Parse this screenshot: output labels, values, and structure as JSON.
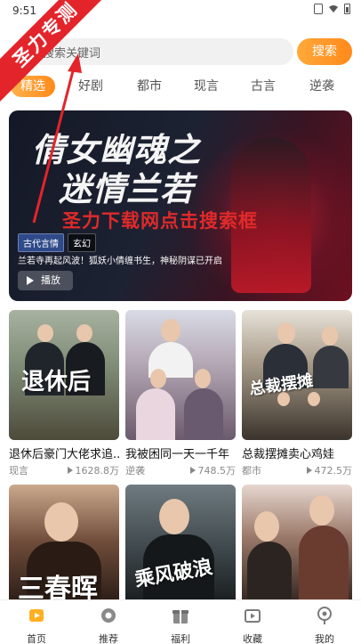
{
  "status_bar": {
    "time": "9:51"
  },
  "overlay": {
    "ribbon_text": "圣力专测",
    "banner_watermark": "圣力下载网点击搜索框"
  },
  "search": {
    "placeholder": "搜索关键词",
    "button_label": "搜索"
  },
  "tabs": [
    {
      "label": "精选",
      "active": true
    },
    {
      "label": "好剧",
      "active": false
    },
    {
      "label": "都市",
      "active": false
    },
    {
      "label": "现言",
      "active": false
    },
    {
      "label": "古言",
      "active": false
    },
    {
      "label": "逆袭",
      "active": false
    }
  ],
  "banner": {
    "title_line1": "倩女幽魂之",
    "title_line2": "迷情兰若",
    "tags": [
      "古代言情",
      "玄幻"
    ],
    "description": "兰若寺再起风波！狐妖小倩缠书生，神秘阴谋已开启",
    "play_label": "播放"
  },
  "cards": [
    {
      "title": "退休后豪门大佬求追...",
      "genre": "现言",
      "plays": "1628.8万",
      "poster_text": "退休后"
    },
    {
      "title": "我被困同一天一千年",
      "genre": "逆袭",
      "plays": "748.5万",
      "poster_text": ""
    },
    {
      "title": "总裁摆摊卖心鸡娃",
      "genre": "都市",
      "plays": "472.5万",
      "poster_text": "总裁摆摊"
    },
    {
      "title": "",
      "genre": "",
      "plays": "",
      "poster_text": "三春晖"
    },
    {
      "title": "",
      "genre": "",
      "plays": "",
      "poster_text": "乘风破浪"
    },
    {
      "title": "",
      "genre": "",
      "plays": "",
      "poster_text": ""
    }
  ],
  "bottom_nav": [
    {
      "label": "首页",
      "icon": "home-icon",
      "active": true
    },
    {
      "label": "推荐",
      "icon": "gear-icon",
      "active": false
    },
    {
      "label": "福利",
      "icon": "gift-icon",
      "active": false
    },
    {
      "label": "收藏",
      "icon": "tv-icon",
      "active": false
    },
    {
      "label": "我的",
      "icon": "profile-icon",
      "active": false
    }
  ],
  "colors": {
    "accent": "#ff9a2a",
    "ribbon": "#e3242b"
  }
}
